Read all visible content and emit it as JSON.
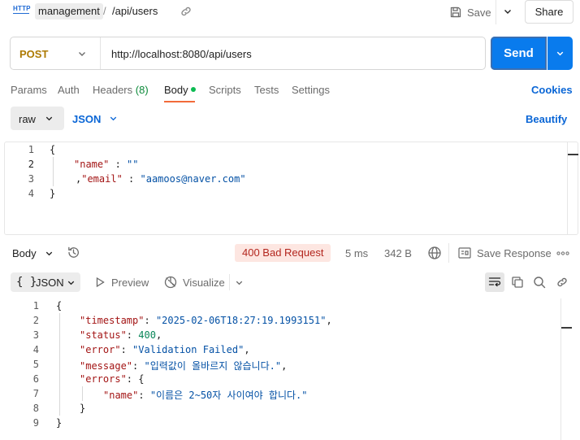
{
  "header": {
    "http_icon_label": "HTTP",
    "collection": "management",
    "separator": "/",
    "request_name": "/api/users",
    "save_label": "Save",
    "share_label": "Share"
  },
  "request": {
    "method": "POST",
    "method_color": "#ad7a03",
    "url": "http://localhost:8080/api/users",
    "send_label": "Send",
    "send_color": "#097bed"
  },
  "tabs": {
    "params": "Params",
    "auth": "Auth",
    "headers": "Headers",
    "headers_count": "(8)",
    "body": "Body",
    "scripts": "Scripts",
    "tests": "Tests",
    "settings": "Settings",
    "cookies": "Cookies",
    "active": "Body",
    "accent_color": "#f26b3a"
  },
  "body_options": {
    "mode": "raw",
    "language": "JSON",
    "beautify": "Beautify"
  },
  "request_body": {
    "line_numbers": [
      "1",
      "2",
      "3",
      "4"
    ],
    "open_brace": "{",
    "name_key": "\"name\"",
    "name_sep": " : ",
    "name_value": "\"\"",
    "email_prefix": ",",
    "email_key": "\"email\"",
    "email_sep": " : ",
    "email_value": "\"aamoos@naver.com\"",
    "close_brace": "}"
  },
  "response": {
    "body_label": "Body",
    "status": "400 Bad Request",
    "status_color": "#b3261e",
    "time": "5 ms",
    "size": "342 B",
    "save_response": "Save Response",
    "format": "JSON",
    "format_braces": "{ }",
    "preview": "Preview",
    "visualize": "Visualize"
  },
  "response_body": {
    "line_numbers": [
      "1",
      "2",
      "3",
      "4",
      "5",
      "6",
      "7",
      "8",
      "9"
    ],
    "open_brace": "{",
    "timestamp_key": "\"timestamp\"",
    "timestamp_value": "\"2025-02-06T18:27:19.1993151\"",
    "status_key": "\"status\"",
    "status_value": "400",
    "error_key": "\"error\"",
    "error_value": "\"Validation Failed\"",
    "message_key": "\"message\"",
    "message_value": "\"입력값이 올바르지 않습니다.\"",
    "errors_key": "\"errors\"",
    "errors_open": "{",
    "errors_name_key": "\"name\"",
    "errors_name_value": "\"이름은 2~50자 사이여야 합니다.\"",
    "errors_close": "}",
    "close_brace": "}",
    "colon": ": ",
    "comma": ","
  }
}
